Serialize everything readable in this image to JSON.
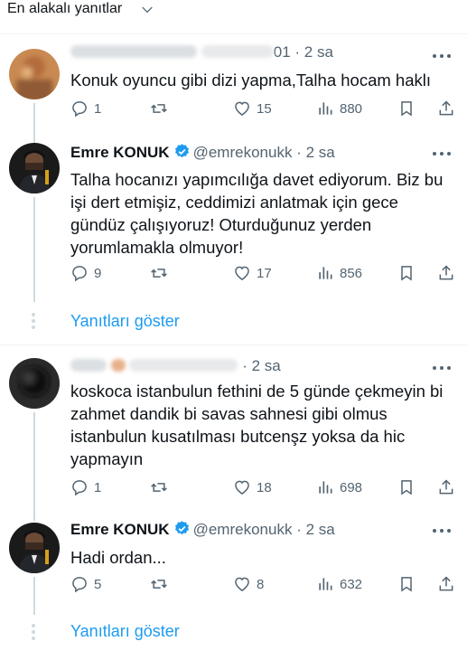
{
  "sort": {
    "label": "En alakalı yanıtlar"
  },
  "colors": {
    "accent": "#1d9bf0",
    "muted": "#536471",
    "text": "#0f1419",
    "verified": "#1d9bf0",
    "line": "#cfd9de"
  },
  "threads": [
    {
      "reply": {
        "author_visible_suffix": "01",
        "dot": "·",
        "time": "2 sa",
        "text": "Konuk oyuncu gibi dizi yapma,Talha hocam haklı",
        "counts": {
          "replies": "1",
          "retweets": "",
          "likes": "15",
          "views": "880"
        }
      },
      "response": {
        "name": "Emre KONUK",
        "handle": "@emrekonukk",
        "dot": "·",
        "time": "2 sa",
        "text": "Talha hocanızı yapımcılığa davet ediyorum. Biz bu işi dert etmişiz, ceddimizi anlatmak için gece gündüz çalışıyoruz! Oturduğunuz yerden yorumlamakla olmuyor!",
        "counts": {
          "replies": "9",
          "retweets": "",
          "likes": "17",
          "views": "856"
        }
      },
      "show_replies": "Yanıtları göster"
    },
    {
      "reply": {
        "dot": "·",
        "time": "2 sa",
        "text": "koskoca istanbulun fethini de 5 günde çekmeyin bi zahmet dandik bi savas sahnesi gibi olmus istanbulun kusatılması butcenşz yoksa da hic yapmayın",
        "counts": {
          "replies": "1",
          "retweets": "",
          "likes": "18",
          "views": "698"
        }
      },
      "response": {
        "name": "Emre KONUK",
        "handle": "@emrekonukk",
        "dot": "·",
        "time": "2 sa",
        "text": "Hadi ordan...",
        "counts": {
          "replies": "5",
          "retweets": "",
          "likes": "8",
          "views": "632"
        }
      },
      "show_replies": "Yanıtları göster"
    }
  ],
  "icons": [
    "chevron-down-icon",
    "more-icon",
    "reply-icon",
    "retweet-icon",
    "like-icon",
    "views-icon",
    "bookmark-icon",
    "share-icon",
    "verified-badge-icon"
  ]
}
